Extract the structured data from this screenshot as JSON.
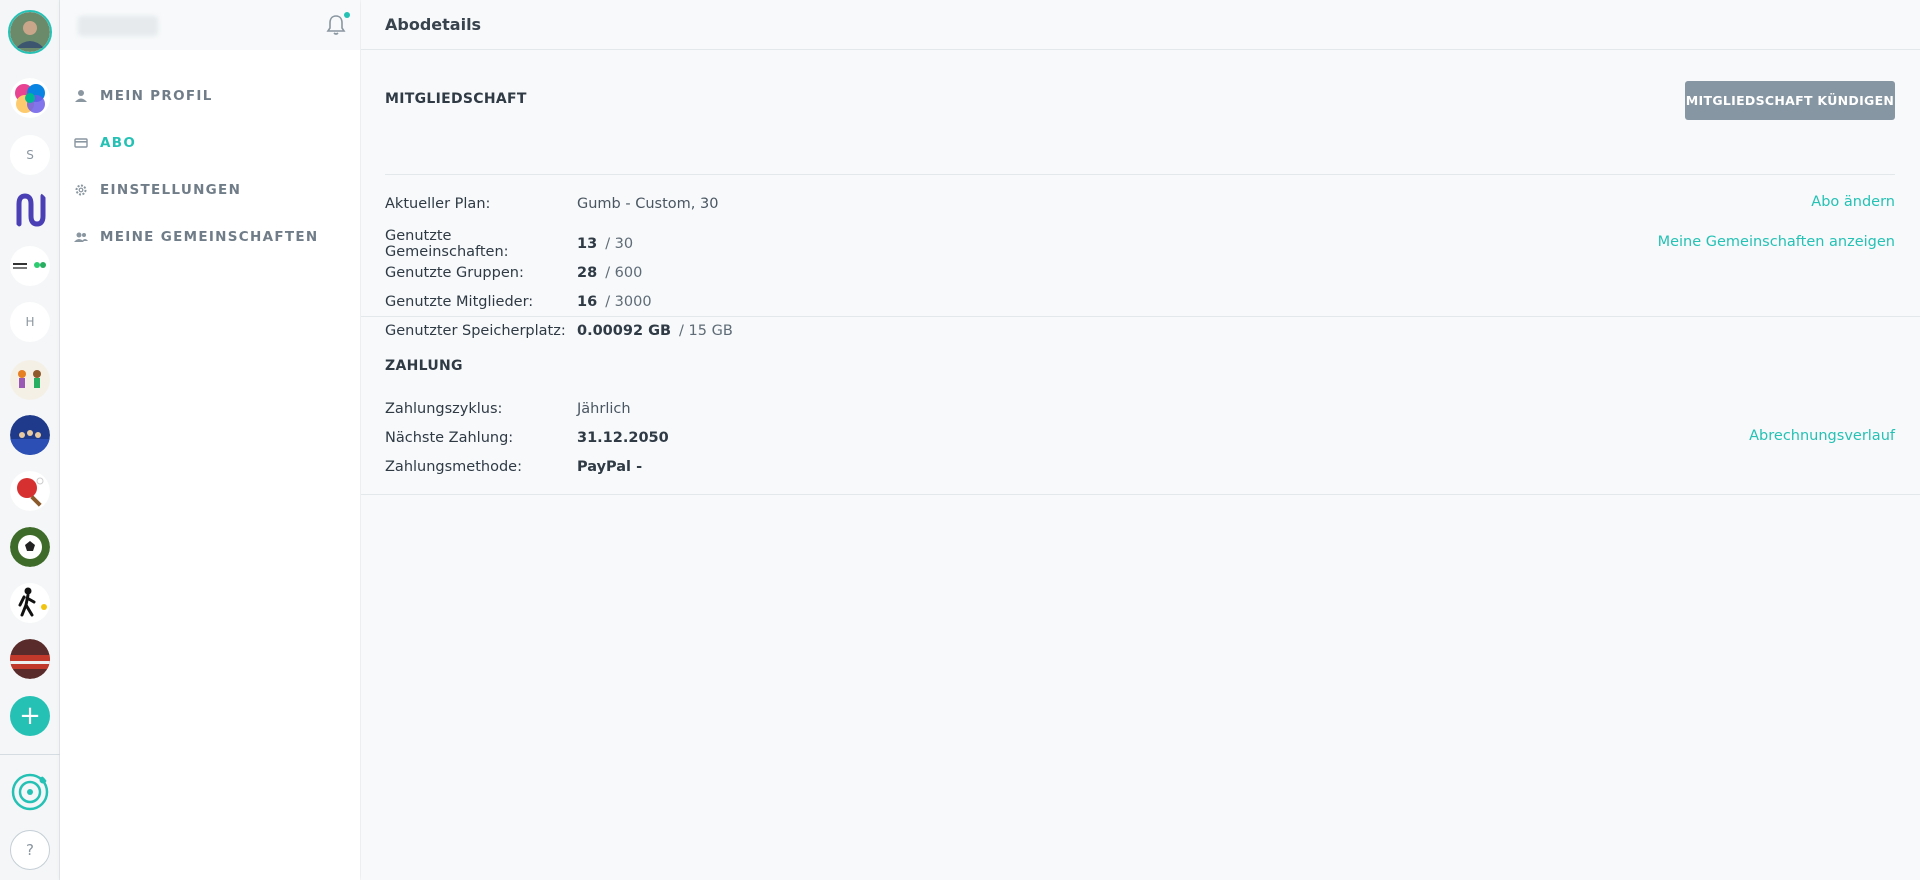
{
  "rail": {
    "letters": [
      "S",
      "H"
    ],
    "add_label": "+",
    "help_label": "?",
    "colors": {
      "accent": "#26c1b5"
    }
  },
  "sidebar": {
    "items": [
      {
        "label": "MEIN PROFIL",
        "icon": "person-icon"
      },
      {
        "label": "ABO",
        "icon": "credit-card-icon",
        "active": true
      },
      {
        "label": "EINSTELLUNGEN",
        "icon": "gear-icon"
      },
      {
        "label": "MEINE GEMEINSCHAFTEN",
        "icon": "group-icon"
      }
    ]
  },
  "main": {
    "title": "Abodetails",
    "membership": {
      "title": "MITGLIEDSCHAFT",
      "cancel_label": "MITGLIEDSCHAFT KÜNDIGEN",
      "plan_label": "Aktueller Plan:",
      "plan_value": "Gumb - Custom, 30",
      "change_link": "Abo ändern",
      "communities_link": "Meine Gemeinschaften anzeigen",
      "usage": [
        {
          "label": "Genutzte Gemeinschaften:",
          "used": "13",
          "limit": "/ 30"
        },
        {
          "label": "Genutzte Gruppen:",
          "used": "28",
          "limit": "/ 600"
        },
        {
          "label": "Genutzte Mitglieder:",
          "used": "16",
          "limit": "/ 3000"
        },
        {
          "label": "Genutzter Speicherplatz:",
          "used": "0.00092 GB",
          "limit": "/ 15 GB"
        }
      ]
    },
    "payment": {
      "title": "ZAHLUNG",
      "cycle_label": "Zahlungszyklus:",
      "cycle_value": "Jährlich",
      "next_label": "Nächste Zahlung:",
      "next_value": "31.12.2050",
      "method_label": "Zahlungsmethode:",
      "method_value": "PayPal -",
      "history_link": "Abrechnungsverlauf"
    }
  }
}
